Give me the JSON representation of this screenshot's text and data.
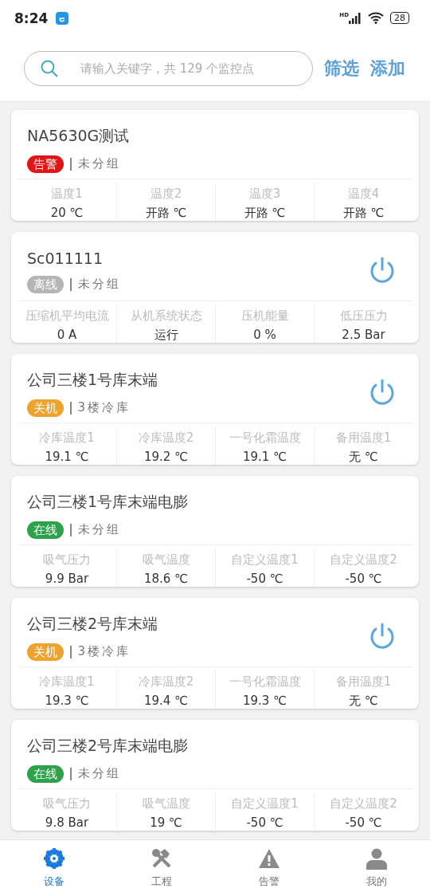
{
  "status_bar": {
    "time": "8:24",
    "battery": "28",
    "network": "HD"
  },
  "search": {
    "placeholder": "请输入关键字，共 129 个监控点"
  },
  "actions": [
    "筛选",
    "添加"
  ],
  "devices": [
    {
      "name": "NA5630G测试",
      "status": {
        "kind": "alarm",
        "label": "告警"
      },
      "group": "未分组",
      "power_button": false,
      "metrics": [
        {
          "label": "温度1",
          "value": "20 ℃"
        },
        {
          "label": "温度2",
          "value": "开路 ℃"
        },
        {
          "label": "温度3",
          "value": "开路 ℃"
        },
        {
          "label": "温度4",
          "value": "开路 ℃"
        }
      ]
    },
    {
      "name": "Sc011111",
      "status": {
        "kind": "offline",
        "label": "离线"
      },
      "group": "未分组",
      "power_button": true,
      "metrics": [
        {
          "label": "压缩机平均电流",
          "value": "0 A"
        },
        {
          "label": "从机系统状态",
          "value": "运行"
        },
        {
          "label": "压机能量",
          "value": "0 %"
        },
        {
          "label": "低压压力",
          "value": "2.5 Bar"
        }
      ]
    },
    {
      "name": "公司三楼1号库末端",
      "status": {
        "kind": "off",
        "label": "关机"
      },
      "group": "3楼冷库",
      "power_button": true,
      "metrics": [
        {
          "label": "冷库温度1",
          "value": "19.1 ℃"
        },
        {
          "label": "冷库温度2",
          "value": "19.2 ℃"
        },
        {
          "label": "一号化霜温度",
          "value": "19.1 ℃"
        },
        {
          "label": "备用温度1",
          "value": "无 ℃"
        }
      ]
    },
    {
      "name": "公司三楼1号库末端电膨",
      "status": {
        "kind": "online",
        "label": "在线"
      },
      "group": "未分组",
      "power_button": false,
      "metrics": [
        {
          "label": "吸气压力",
          "value": "9.9 Bar"
        },
        {
          "label": "吸气温度",
          "value": "18.6 ℃"
        },
        {
          "label": "自定义温度1",
          "value": "-50 ℃"
        },
        {
          "label": "自定义温度2",
          "value": "-50 ℃"
        }
      ]
    },
    {
      "name": "公司三楼2号库末端",
      "status": {
        "kind": "off",
        "label": "关机"
      },
      "group": "3楼冷库",
      "power_button": true,
      "metrics": [
        {
          "label": "冷库温度1",
          "value": "19.3 ℃"
        },
        {
          "label": "冷库温度2",
          "value": "19.4 ℃"
        },
        {
          "label": "一号化霜温度",
          "value": "19.3 ℃"
        },
        {
          "label": "备用温度1",
          "value": "无 ℃"
        }
      ]
    },
    {
      "name": "公司三楼2号库末端电膨",
      "status": {
        "kind": "online",
        "label": "在线"
      },
      "group": "未分组",
      "power_button": false,
      "metrics": [
        {
          "label": "吸气压力",
          "value": "9.8 Bar"
        },
        {
          "label": "吸气温度",
          "value": "19 ℃"
        },
        {
          "label": "自定义温度1",
          "value": "-50 ℃"
        },
        {
          "label": "自定义温度2",
          "value": "-50 ℃"
        }
      ]
    }
  ],
  "tabs": [
    {
      "label": "设备",
      "selected": true
    },
    {
      "label": "工程",
      "selected": false
    },
    {
      "label": "告警",
      "selected": false
    },
    {
      "label": "我的",
      "selected": false
    }
  ]
}
